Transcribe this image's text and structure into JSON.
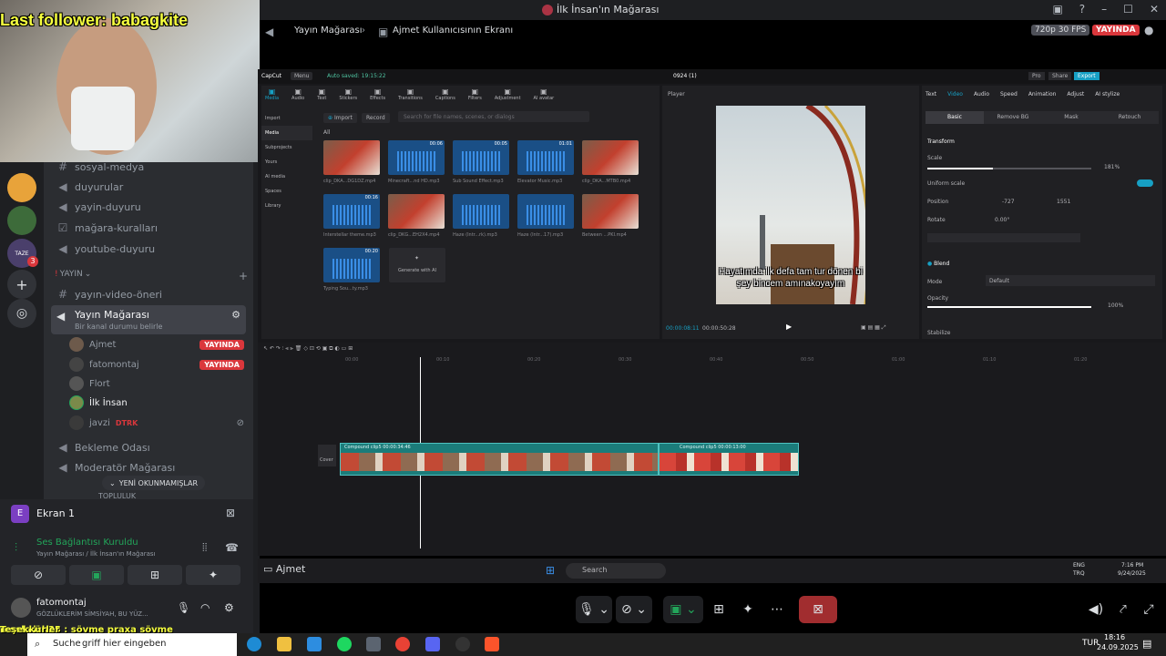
{
  "window": {
    "title": "İlk İnsan'ın Mağarası"
  },
  "overlay": {
    "follower_text": "Last follower: babagkite"
  },
  "servers": {
    "badge": "3",
    "label_small": "TAZE"
  },
  "channels": [
    {
      "name": "sosyal-medya",
      "icon": "#"
    },
    {
      "name": "duyurular",
      "icon": "◀"
    },
    {
      "name": "yayin-duyuru",
      "icon": "◀"
    },
    {
      "name": "mağara-kuralları",
      "icon": "☑"
    },
    {
      "name": "youtube-duyuru",
      "icon": "◀"
    }
  ],
  "category": {
    "name": "YAYIN",
    "prefix": "!"
  },
  "channel_yayin_oneri": "yayın-video-öneri",
  "active_voice": {
    "name": "Yayın Mağarası",
    "status": "Bir kanal durumu belirle"
  },
  "voice_users": [
    {
      "name": "Ajmet",
      "live": "YAYINDA"
    },
    {
      "name": "fatomontaj",
      "live": "YAYINDA"
    },
    {
      "name": "Flort",
      "live": ""
    },
    {
      "name": "İlk İnsan",
      "live": ""
    },
    {
      "name": "javzi",
      "live": "",
      "tag": "DTRK"
    }
  ],
  "other_voice": [
    "Bekleme Odası",
    "Moderatör Mağarası"
  ],
  "unread_pill": "YENİ OKUNMAMIŞLAR",
  "cut_off_category": "TOPLULUK",
  "screen_panel": {
    "title": "Ekran 1",
    "icon_letter": "E"
  },
  "voice_connection": {
    "status": "Ses Bağlantısı Kuruldu",
    "location": "Yayın Mağarası / İlk İnsan'ın Mağarası"
  },
  "user_panel": {
    "name": "fatomontaj",
    "status": "GÖZLÜKLERİM SİMSİYAH, BU YÜZ..."
  },
  "chat_line": {
    "author": "moskvich35",
    "text": ": sövme praxa sövme"
  },
  "chat_prefix": "Teşekkürler",
  "stream_header": {
    "channel": "Yayın Mağarası",
    "screen": "Ajmet Kullanıcısının Ekranı",
    "quality": "720p 30 FPS",
    "live": "YAYINDA"
  },
  "capcut": {
    "logo": "CapCut",
    "menu": "Menu",
    "autosave": "Auto saved: 19:15:22",
    "project": "0924 (1)",
    "pro": "Pro",
    "share": "Share",
    "export": "Export",
    "tools": [
      "Media",
      "Audio",
      "Text",
      "Stickers",
      "Effects",
      "Transitions",
      "Captions",
      "Filters",
      "Adjustment",
      "AI avatar"
    ],
    "side": [
      "Import",
      "Media",
      "Subprojects",
      "Yours",
      "AI media",
      "Spaces",
      "Library"
    ],
    "import_btn": "Import",
    "record_btn": "Record",
    "search_placeholder": "Search for file names, scenes, or dialogs",
    "all_label": "All",
    "media_items": [
      {
        "label": "clip_DKA...DG1DZ.mp4",
        "time": "",
        "kind": "img"
      },
      {
        "label": "Minecraft...nd HD.mp3",
        "time": "00:06",
        "kind": "audio"
      },
      {
        "label": "Sub Sound Effect.mp3",
        "time": "00:05",
        "kind": "audio"
      },
      {
        "label": "Elevator Music.mp3",
        "time": "01:01",
        "kind": "audio"
      },
      {
        "label": "clip_DKA...MTB0.mp4",
        "time": "",
        "kind": "img"
      },
      {
        "label": "Interstellar theme.mp3",
        "time": "00:16",
        "kind": "audio"
      },
      {
        "label": "clip_DKG...EH2X4.mp4",
        "time": "",
        "kind": "img"
      },
      {
        "label": "Haze (Intr...rk).mp3",
        "time": "",
        "kind": "audio"
      },
      {
        "label": "Haze (Intr...17).mp3",
        "time": "",
        "kind": "audio"
      },
      {
        "label": "Between ...PKI.mp4",
        "time": "",
        "kind": "img"
      },
      {
        "label": "Typing Sou...ty.mp3",
        "time": "00:20",
        "kind": "audio"
      }
    ],
    "generate_ai": "Generate with AI",
    "player_title": "Player",
    "subtitle": "Hayatımda ilk defa tam tur dönen bi şey bincem amınakoyayım",
    "time_current": "00:00:08:11",
    "time_total": "00:00:50:28",
    "right_tabs": [
      "Text",
      "Video",
      "Audio",
      "Speed",
      "Animation",
      "Adjust",
      "AI stylize"
    ],
    "subtabs": [
      "Basic",
      "Remove BG",
      "Mask",
      "Retouch"
    ],
    "transform": "Transform",
    "scale_label": "Scale",
    "scale_value": "181%",
    "uniform_scale": "Uniform scale",
    "position_label": "Position",
    "pos_x": "-727",
    "pos_y": "1551",
    "rotate_label": "Rotate",
    "rotate_value": "0.00°",
    "blend": "Blend",
    "mode_label": "Mode",
    "mode_value": "Default",
    "opacity_label": "Opacity",
    "opacity_value": "100%",
    "stabilize": "Stabilize",
    "clip1": "Compound clip5  00:00:34:46",
    "clip2": "Compound clip5  00:00:13:00",
    "cover": "Cover",
    "ruler": [
      "00:00",
      "00:10",
      "00:20",
      "00:30",
      "00:40",
      "00:50",
      "01:00",
      "01:10",
      "01:20"
    ]
  },
  "inner_taskbar": {
    "user": "Ajmet",
    "search": "Search",
    "lang": "ENG",
    "lang2": "TRQ",
    "time": "7:16 PM",
    "date": "9/24/2025"
  },
  "win_taskbar": {
    "search_placeholder": "Suche",
    "search_text": "griff hier eingeben",
    "lang": "TUR",
    "time": "18:16",
    "date": "24.09.2025"
  }
}
